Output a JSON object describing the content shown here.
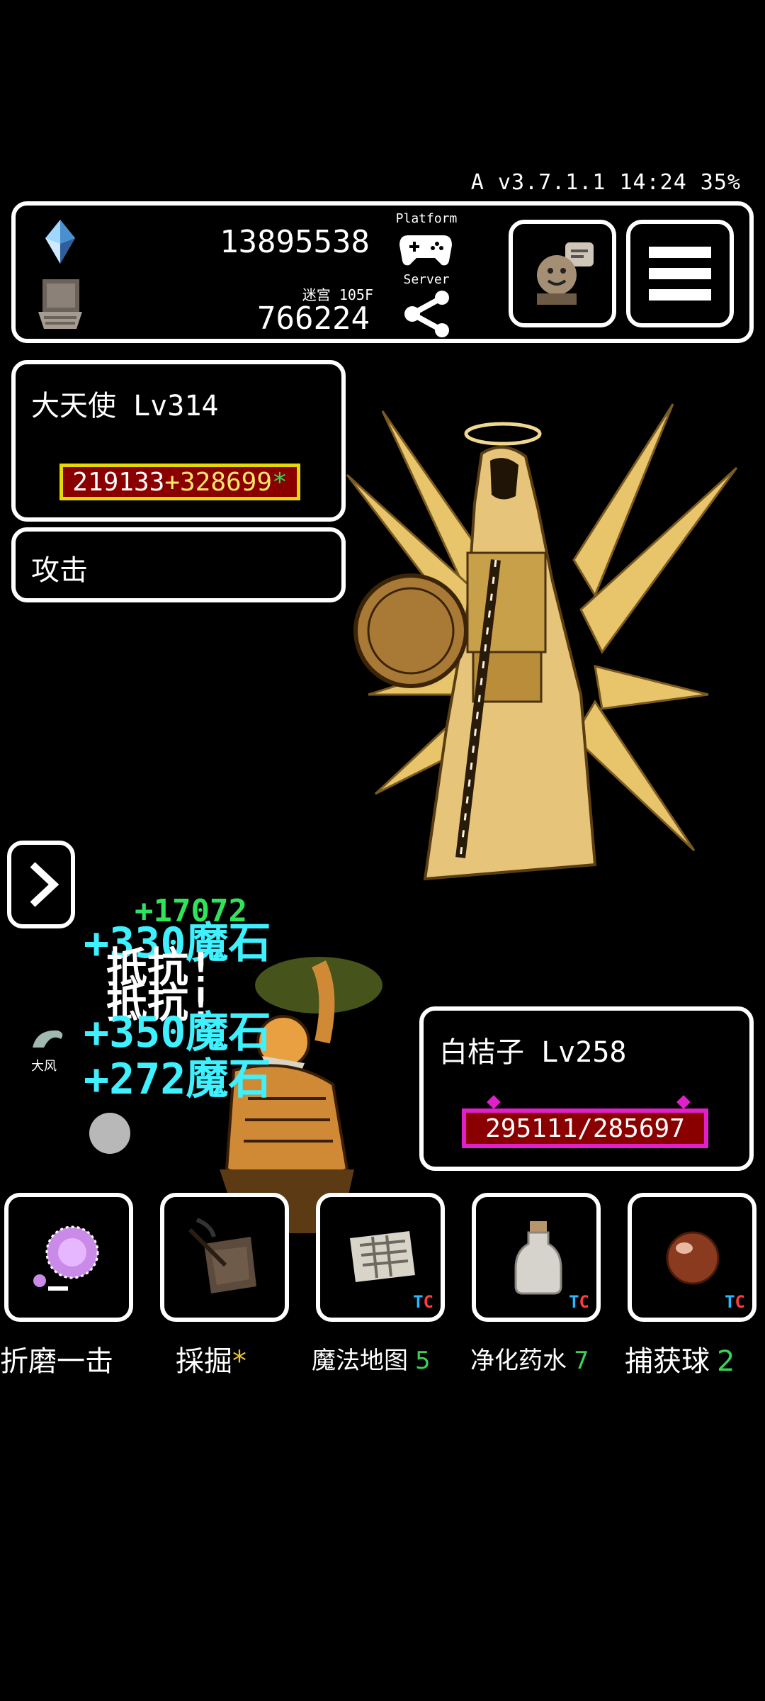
{
  "status_bar": {
    "text": "A v3.7.1.1 14:24 35%"
  },
  "header": {
    "gems": "13895538",
    "dungeon_label": "迷宫 105F",
    "dungeon_value": "766224",
    "platform_label": "Platform",
    "server_label": "Server"
  },
  "enemy": {
    "name": "大天使 Lv314",
    "hp_base": "219133",
    "hp_bonus": "+328699",
    "hp_star": "*",
    "action": "攻击"
  },
  "player": {
    "name": "白桔子 Lv258",
    "hp": "295111/285697"
  },
  "combat_log": {
    "line1": "+330魔石",
    "line2": "抵抗!",
    "line3": "抵抗!",
    "line4": "+350魔石",
    "line5": "+272魔石",
    "green_top": "+17072",
    "companion": "大风"
  },
  "skills": [
    {
      "label": "折磨一击",
      "count": "",
      "tc": false,
      "icon": "purple-magic-orb-icon"
    },
    {
      "label": "採掘",
      "count": "",
      "star": "*",
      "tc": false,
      "icon": "pickaxe-ore-icon"
    },
    {
      "label": "魔法地图",
      "count": "5",
      "tc": true,
      "icon": "magic-map-icon"
    },
    {
      "label": "净化药水",
      "count": "7",
      "tc": true,
      "icon": "potion-bottle-icon"
    },
    {
      "label": "捕获球",
      "count": "2",
      "tc": true,
      "icon": "capture-ball-icon"
    }
  ],
  "tc_badge": {
    "t": "T",
    "c": "C"
  },
  "colors": {
    "hp_bar_enemy_border": "#e6d800",
    "hp_bar_enemy_fill": "#8a0000",
    "hp_bar_player_border": "#e020c8",
    "combat_cyan": "#3ff0ff",
    "count_green": "#39d353"
  }
}
